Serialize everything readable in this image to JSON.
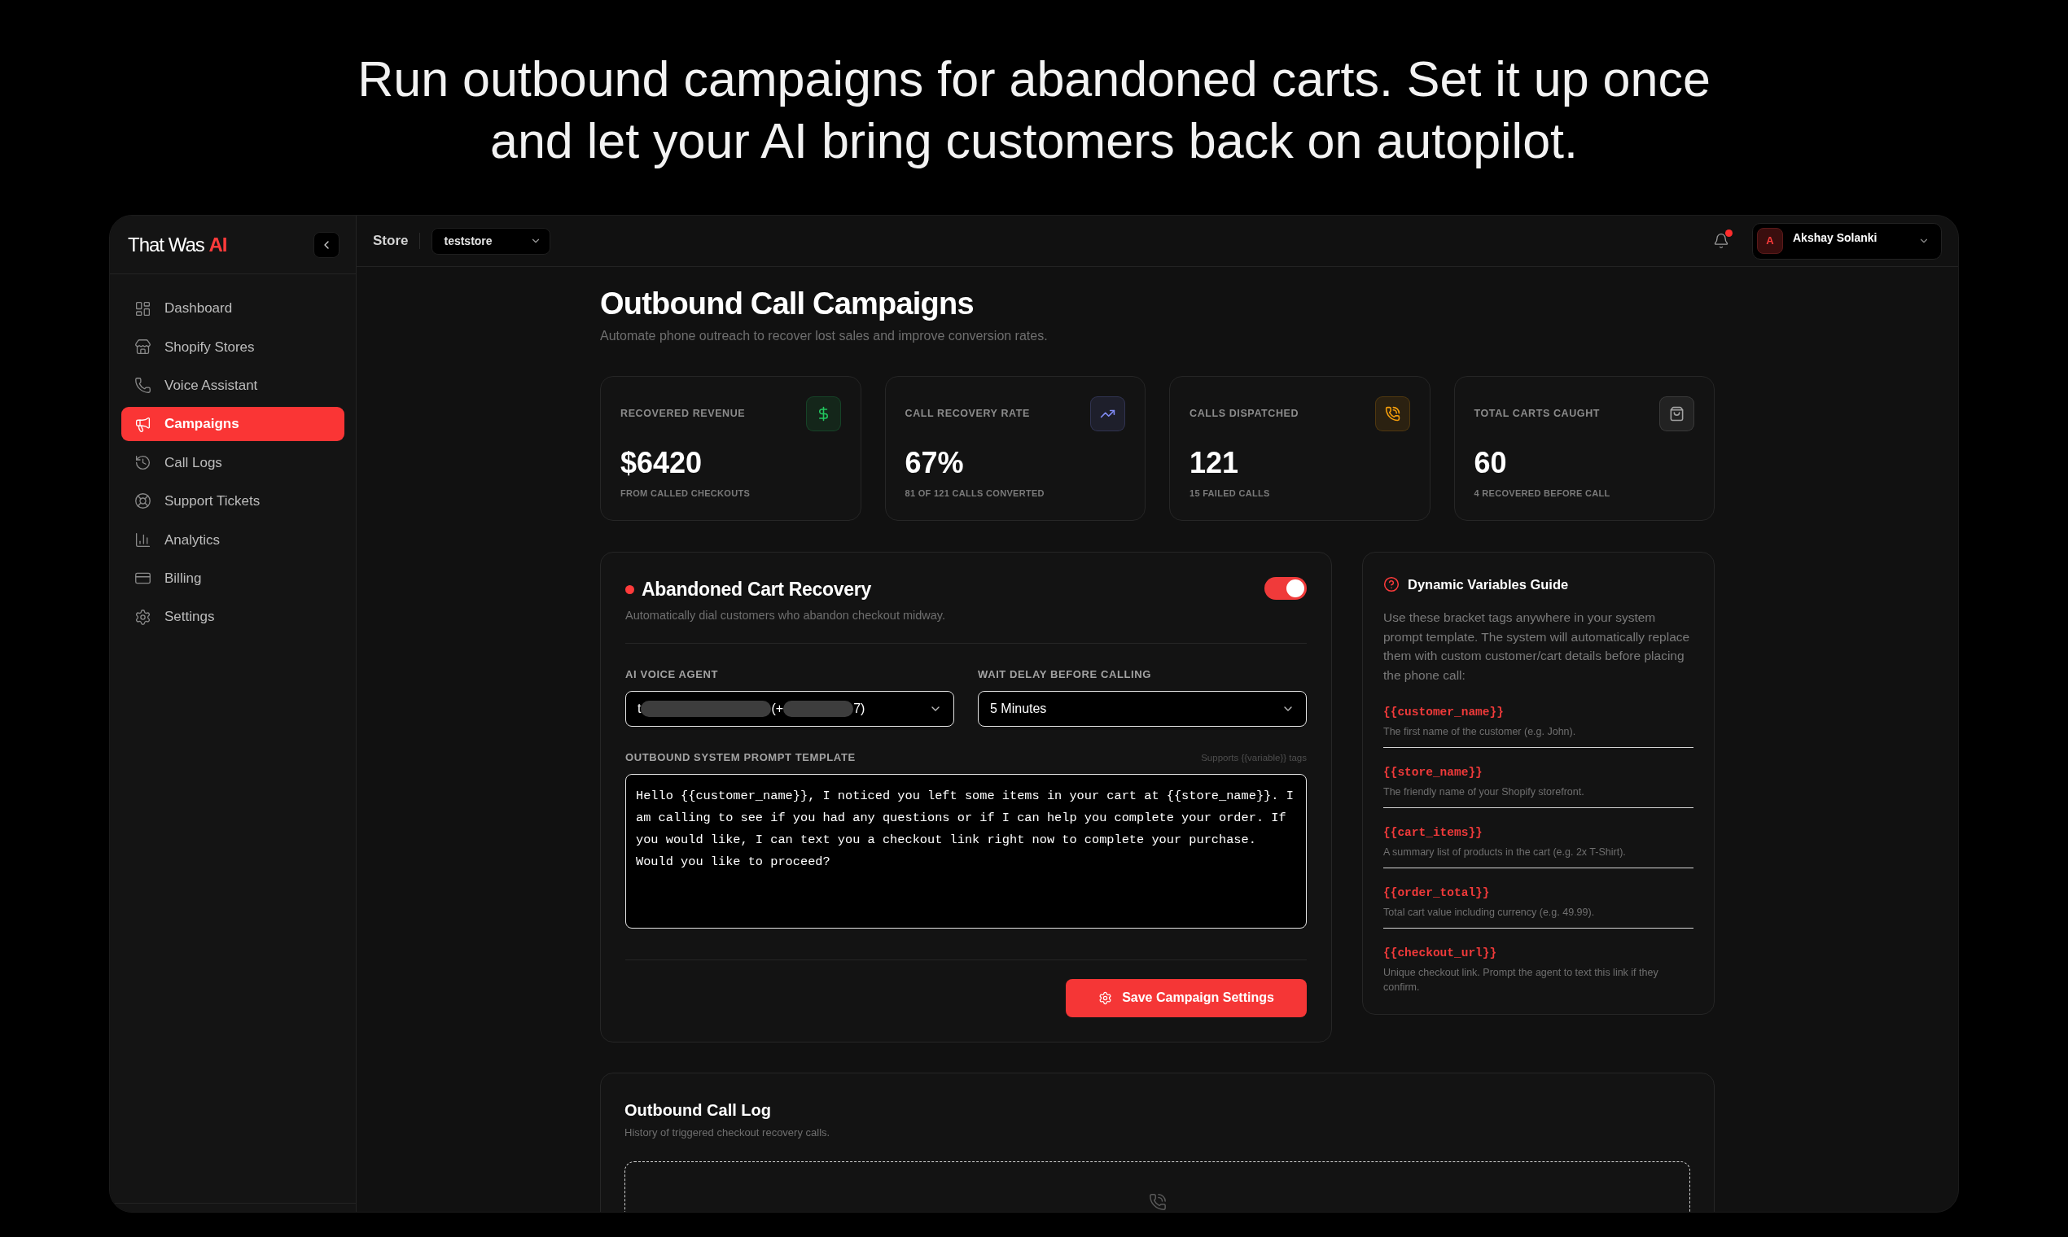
{
  "headline": {
    "lines": [
      "Run outbound campaigns for abandoned carts. Set it up once",
      "and let your AI bring customers back on autopilot."
    ]
  },
  "sidebar": {
    "brand": {
      "text": "That Was",
      "accent": "AI"
    },
    "items": [
      {
        "label": "Dashboard",
        "selected": false
      },
      {
        "label": "Shopify Stores",
        "selected": false
      },
      {
        "label": "Voice Assistant",
        "selected": false
      },
      {
        "label": "Campaigns",
        "selected": true
      },
      {
        "label": "Call Logs",
        "selected": false
      },
      {
        "label": "Support Tickets",
        "selected": false
      },
      {
        "label": "Analytics",
        "selected": false
      },
      {
        "label": "Billing",
        "selected": false
      },
      {
        "label": "Settings",
        "selected": false
      }
    ]
  },
  "topbar": {
    "store_label": "Store",
    "store_select": {
      "value": "teststore"
    },
    "notifications": {
      "unread": true
    },
    "user": {
      "initial": "A",
      "name": "Akshay Solanki"
    }
  },
  "page": {
    "title": "Outbound Call Campaigns",
    "subtitle": "Automate phone outreach to recover lost sales and improve conversion rates."
  },
  "stats": [
    {
      "label": "RECOVERED REVENUE",
      "value": "$6420",
      "note": "FROM CALLED CHECKOUTS",
      "color": "#22c55e"
    },
    {
      "label": "CALL RECOVERY RATE",
      "value": "67%",
      "note": "81 OF 121 CALLS CONVERTED",
      "color": "#818cf8"
    },
    {
      "label": "CALLS DISPATCHED",
      "value": "121",
      "note": "15 FAILED CALLS",
      "color": "#f59e0b"
    },
    {
      "label": "TOTAL CARTS CAUGHT",
      "value": "60",
      "note": "4 RECOVERED BEFORE CALL",
      "color": "#a3a3a3"
    }
  ],
  "campaign": {
    "title": "Abandoned Cart Recovery",
    "description": "Automatically dial customers who abandon checkout midway.",
    "enabled": true,
    "voice_agent": {
      "label": "AI VOICE AGENT",
      "value_fragments": [
        "t",
        "(+",
        "7)"
      ]
    },
    "wait_delay": {
      "label": "WAIT DELAY BEFORE CALLING",
      "value": "5 Minutes"
    },
    "prompt": {
      "label": "OUTBOUND SYSTEM PROMPT TEMPLATE",
      "hint": "Supports {{variable}} tags",
      "value": "Hello {{customer_name}}, I noticed you left some items in your cart at {{store_name}}. I am calling to see if you had any questions or if I can help you complete your order. If you would like, I can text you a checkout link right now to complete your purchase. Would you like to proceed?"
    },
    "save_button": "Save Campaign Settings"
  },
  "variables_guide": {
    "title": "Dynamic Variables Guide",
    "intro": "Use these bracket tags anywhere in your system prompt template. The system will automatically replace them with custom customer/cart details before placing the phone call:",
    "variables": [
      {
        "tag": "{{customer_name}}",
        "description": "The first name of the customer (e.g. John)."
      },
      {
        "tag": "{{store_name}}",
        "description": "The friendly name of your Shopify storefront."
      },
      {
        "tag": "{{cart_items}}",
        "description": "A summary list of products in the cart (e.g. 2x T-Shirt)."
      },
      {
        "tag": "{{order_total}}",
        "description": "Total cart value including currency (e.g. 49.99)."
      },
      {
        "tag": "{{checkout_url}}",
        "description": "Unique checkout link. Prompt the agent to text this link if they confirm."
      }
    ]
  },
  "call_log": {
    "title": "Outbound Call Log",
    "subtitle": "History of triggered checkout recovery calls."
  }
}
